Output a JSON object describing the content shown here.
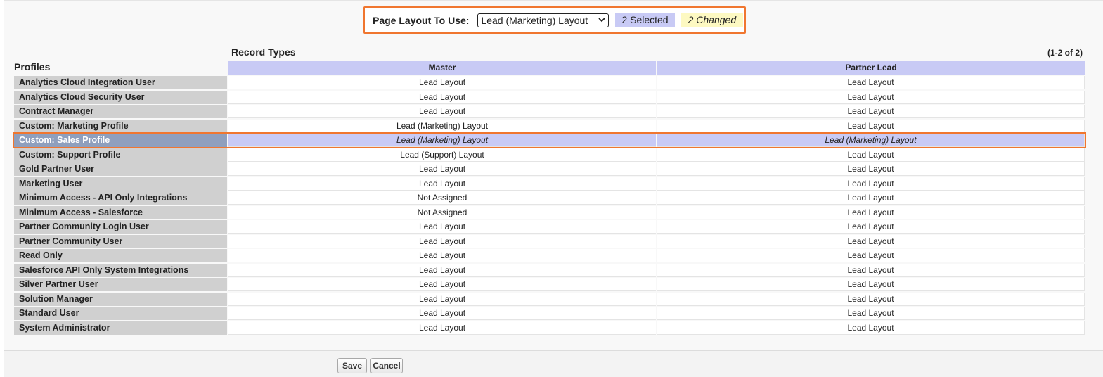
{
  "layout_bar": {
    "label": "Page Layout To Use:",
    "selected_layout": "Lead (Marketing) Layout",
    "selected_badge": "2 Selected",
    "changed_badge": "2 Changed"
  },
  "table": {
    "record_types_label": "Record Types",
    "count": "(1-2 of 2)",
    "profiles_heading": "Profiles",
    "columns": [
      "Master",
      "Partner Lead"
    ],
    "rows": [
      {
        "profile": "Analytics Cloud Integration User",
        "master": "Lead Layout",
        "partner": "Lead Layout"
      },
      {
        "profile": "Analytics Cloud Security User",
        "master": "Lead Layout",
        "partner": "Lead Layout"
      },
      {
        "profile": "Contract Manager",
        "master": "Lead Layout",
        "partner": "Lead Layout"
      },
      {
        "profile": "Custom: Marketing Profile",
        "master": "Lead (Marketing) Layout",
        "partner": "Lead Layout"
      },
      {
        "profile": "Custom: Sales Profile",
        "master": "Lead (Marketing) Layout",
        "partner": "Lead (Marketing) Layout",
        "selected": true
      },
      {
        "profile": "Custom: Support Profile",
        "master": "Lead (Support) Layout",
        "partner": "Lead Layout"
      },
      {
        "profile": "Gold Partner User",
        "master": "Lead Layout",
        "partner": "Lead Layout"
      },
      {
        "profile": "Marketing User",
        "master": "Lead Layout",
        "partner": "Lead Layout"
      },
      {
        "profile": "Minimum Access - API Only Integrations",
        "master": "Not Assigned",
        "partner": "Lead Layout"
      },
      {
        "profile": "Minimum Access - Salesforce",
        "master": "Not Assigned",
        "partner": "Lead Layout"
      },
      {
        "profile": "Partner Community Login User",
        "master": "Lead Layout",
        "partner": "Lead Layout"
      },
      {
        "profile": "Partner Community User",
        "master": "Lead Layout",
        "partner": "Lead Layout"
      },
      {
        "profile": "Read Only",
        "master": "Lead Layout",
        "partner": "Lead Layout"
      },
      {
        "profile": "Salesforce API Only System Integrations",
        "master": "Lead Layout",
        "partner": "Lead Layout"
      },
      {
        "profile": "Silver Partner User",
        "master": "Lead Layout",
        "partner": "Lead Layout"
      },
      {
        "profile": "Solution Manager",
        "master": "Lead Layout",
        "partner": "Lead Layout"
      },
      {
        "profile": "Standard User",
        "master": "Lead Layout",
        "partner": "Lead Layout"
      },
      {
        "profile": "System Administrator",
        "master": "Lead Layout",
        "partner": "Lead Layout"
      }
    ]
  },
  "buttons": {
    "save": "Save",
    "cancel": "Cancel"
  }
}
